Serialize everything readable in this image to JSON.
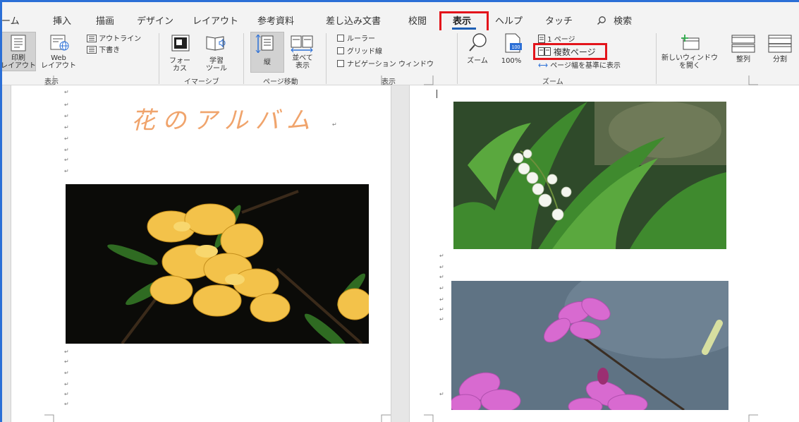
{
  "tabs": [
    {
      "label": "ホーム"
    },
    {
      "label": "挿入"
    },
    {
      "label": "描画"
    },
    {
      "label": "デザイン"
    },
    {
      "label": "レイアウト"
    },
    {
      "label": "参考資料"
    },
    {
      "label": "差し込み文書"
    },
    {
      "label": "校閲"
    },
    {
      "label": "表示",
      "active": true
    },
    {
      "label": "ヘルプ"
    },
    {
      "label": "タッチ"
    }
  ],
  "search": {
    "label": "検索"
  },
  "ribbon": {
    "views": {
      "print_layout": "印刷\nレイアウト",
      "web_layout": "Web\nレイアウト",
      "outline": "アウトライン",
      "draft": "下書き",
      "group": "表示"
    },
    "immersive": {
      "focus": "フォー\nカス",
      "learning_tools": "学習\nツール",
      "group": "イマーシブ"
    },
    "page_movement": {
      "vertical": "縦",
      "side_by_side": "並べて\n表示",
      "group": "ページ移動"
    },
    "show": {
      "ruler": "ルーラー",
      "gridlines": "グリッド線",
      "navigation_pane": "ナビゲーション ウィンドウ",
      "group": "表示"
    },
    "zoom": {
      "zoom": "ズーム",
      "hundred_percent": "100%",
      "one_page": "1 ページ",
      "multiple_pages": "複数ページ",
      "page_width": "ページ幅を基準に表示",
      "group": "ズーム"
    },
    "window": {
      "new_window": "新しいウィンドウ\nを開く",
      "arrange_all": "整列",
      "split": "分割"
    }
  },
  "document": {
    "title": "花のアルバム",
    "paragraph_mark": "↵"
  },
  "colors": {
    "accent": "#1e5fb4",
    "highlight_box": "#e3141b",
    "title_text": "#f0a46c",
    "window_border": "#2b6fd6"
  }
}
